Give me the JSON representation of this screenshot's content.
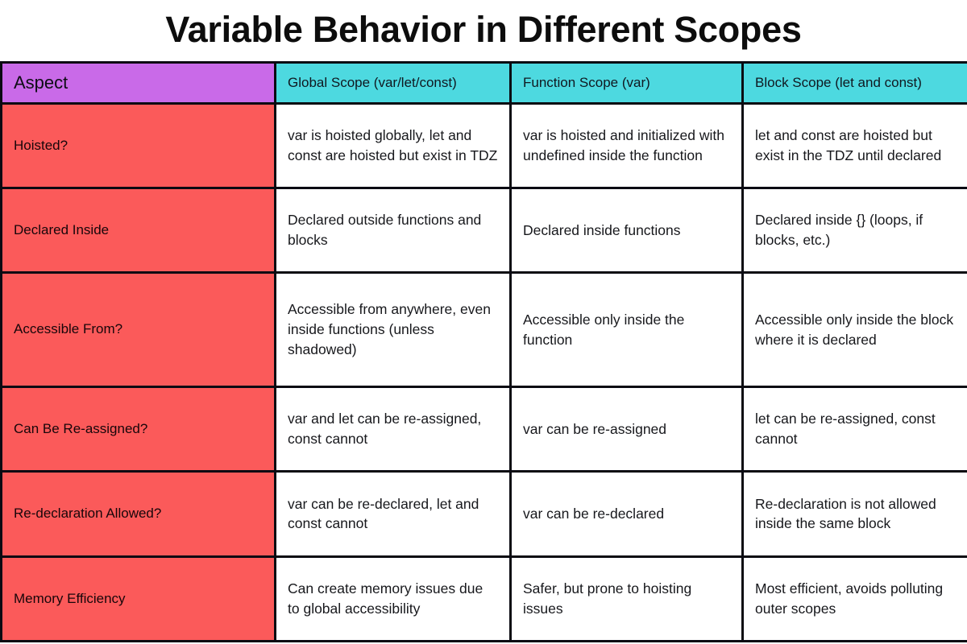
{
  "page": {
    "title": "Variable Behavior in Different Scopes"
  },
  "colors": {
    "aspect_header_bg": "#c96ae8",
    "scope_header_bg": "#4dd9e0",
    "aspect_cell_bg": "#fb5a5a",
    "body_cell_bg": "#ffffff",
    "border": "#0a0a12",
    "text": "#17181c"
  },
  "table": {
    "headers": [
      "Aspect",
      "Global Scope (var/let/const)",
      "Function Scope (var)",
      "Block Scope (let and const)"
    ],
    "rows": [
      {
        "aspect": "Hoisted?",
        "global": "var is hoisted globally, let and const are hoisted but exist in TDZ",
        "function": "var is hoisted and initialized with undefined inside the function",
        "block": "let and const are hoisted but exist in the TDZ until declared"
      },
      {
        "aspect": "Declared Inside",
        "global": "Declared outside functions and blocks",
        "function": "Declared inside functions",
        "block": "Declared inside {} (loops, if blocks, etc.)"
      },
      {
        "aspect": "Accessible From?",
        "global": "Accessible from anywhere, even inside functions (unless shadowed)",
        "function": "Accessible only inside the function",
        "block": "Accessible only inside the block where it is declared"
      },
      {
        "aspect": "Can Be Re-assigned?",
        "global": "var and let can be re-assigned, const cannot",
        "function": "var can be re-assigned",
        "block": "let can be re-assigned, const cannot"
      },
      {
        "aspect": "Re-declaration Allowed?",
        "global": "var can be re-declared, let and const cannot",
        "function": "var can be re-declared",
        "block": "Re-declaration is not allowed inside the same block"
      },
      {
        "aspect": "Memory Efficiency",
        "global": "Can create memory issues due to global accessibility",
        "function": "Safer, but prone to hoisting issues",
        "block": "Most efficient, avoids polluting outer scopes"
      }
    ]
  }
}
